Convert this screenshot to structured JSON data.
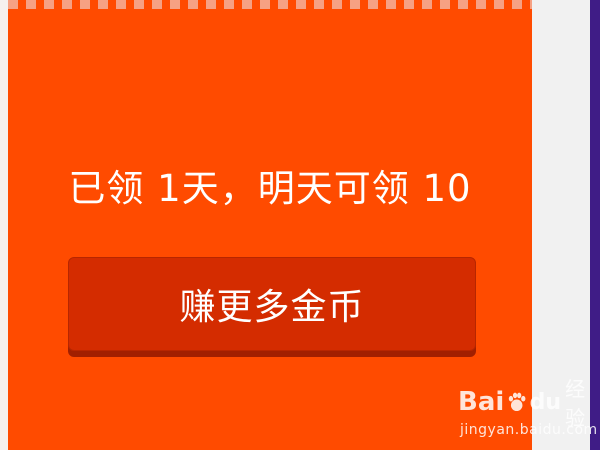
{
  "panel": {
    "message": "已领 1天，明天可领 10",
    "button_label": "赚更多金币"
  },
  "watermark": {
    "brand_bai": "Bai",
    "brand_du": "du",
    "brand_jingyan": "经验",
    "url": "jingyan.baidu.com",
    "icon": "baidu-paw-icon"
  },
  "colors": {
    "panel_bg": "#ff4b00",
    "button_bg": "#d42c00",
    "text": "#ffffff",
    "side_bar": "#3f1c86"
  }
}
